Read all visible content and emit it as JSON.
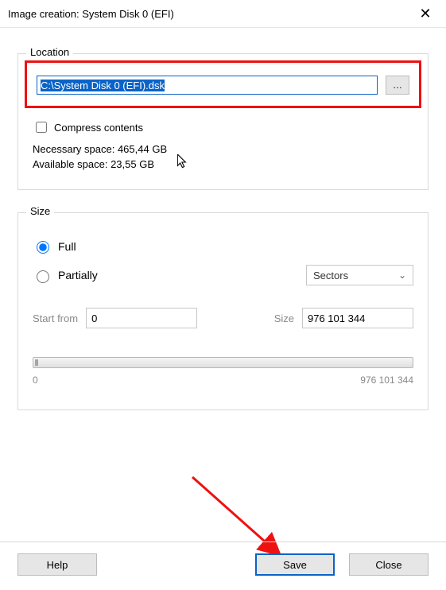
{
  "window": {
    "title": "Image creation: System Disk 0 (EFI)"
  },
  "location": {
    "legend": "Location",
    "path": "C:\\System Disk 0 (EFI).dsk",
    "browse_glyph": "…",
    "compress_label": "Compress contents",
    "compress_checked": false,
    "necessary_label": "Necessary space:",
    "necessary_value": "465,44 GB",
    "available_label": "Available space:",
    "available_value": "23,55 GB"
  },
  "size": {
    "legend": "Size",
    "full_label": "Full",
    "partially_label": "Partially",
    "selected": "full",
    "unit_selected": "Sectors",
    "start_label": "Start from",
    "start_value": "0",
    "size_label": "Size",
    "size_value": "976 101 344",
    "scale_min": "0",
    "scale_max": "976 101 344"
  },
  "buttons": {
    "help": "Help",
    "save": "Save",
    "close": "Close"
  }
}
